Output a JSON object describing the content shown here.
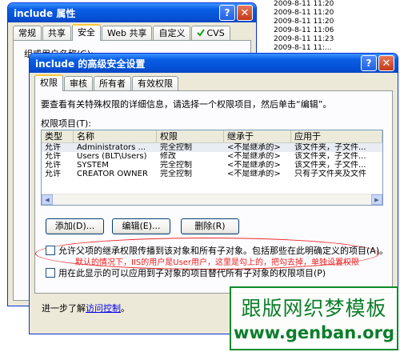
{
  "background_list": {
    "dates": [
      "2009-8-11 11:20",
      "2009-8-11 11:20",
      "2009-8-11 11:20",
      "2009-8-11 11:06",
      "2009-8-11 11:23",
      "2009-8-11 11:..."
    ]
  },
  "properties_window": {
    "title": "include 属性",
    "help_icon": "?",
    "close_icon": "✕",
    "tabs": [
      "常规",
      "共享",
      "安全",
      "Web 共享",
      "自定义",
      "CVS"
    ],
    "active_tab": "安全",
    "group_label": "组或用户名称(G):"
  },
  "security_window": {
    "title": "include 的高级安全设置",
    "help_icon": "?",
    "close_icon": "✕",
    "tabs": [
      "权限",
      "审核",
      "所有者",
      "有效权限"
    ],
    "active_tab": "权限",
    "instructions": "要查看有关特殊权限的详细信息，请选择一个权限项目，然后单击“编辑”。",
    "permissions_label": "权限项目(T):",
    "columns": [
      "类型",
      "名称",
      "权限",
      "继承于",
      "应用于"
    ],
    "rows": [
      {
        "type": "允许",
        "name": "Administrators ...",
        "perm": "完全控制",
        "inherit": "<不是继承的>",
        "apply": "该文件夹，子文件..."
      },
      {
        "type": "允许",
        "name": "Users (BLT\\Users)",
        "perm": "修改",
        "inherit": "<不是继承的>",
        "apply": "该文件夹，子文件..."
      },
      {
        "type": "允许",
        "name": "SYSTEM",
        "perm": "完全控制",
        "inherit": "<不是继承的>",
        "apply": "该文件夹，子文件..."
      },
      {
        "type": "允许",
        "name": "CREATOR OWNER",
        "perm": "完全控制",
        "inherit": "<不是继承的>",
        "apply": "只有子文件夹及文件"
      }
    ],
    "buttons": {
      "add": "添加(D)...",
      "edit": "编辑(E)...",
      "remove": "删除(R)"
    },
    "checkbox_inherit": {
      "label": "允许父项的继承权限传播到该对象和所有子对象。包括那些在此明确定义的项目(A)。",
      "checked": false
    },
    "checkbox_replace": {
      "label": "用在此显示的可以应用到子对象的项目替代所有子对象的权限项目(P)",
      "checked": false
    },
    "annotation": "默认的情况下，IIS的用户是User用户，这里是勾上的，把勾去掉，单独设置权限",
    "learn_more_prefix": "进一步了解",
    "learn_more_link": "访问控制",
    "learn_more_suffix": "。"
  },
  "watermark": {
    "line1": "跟版网织梦模板",
    "line2": "www.genban.org"
  }
}
